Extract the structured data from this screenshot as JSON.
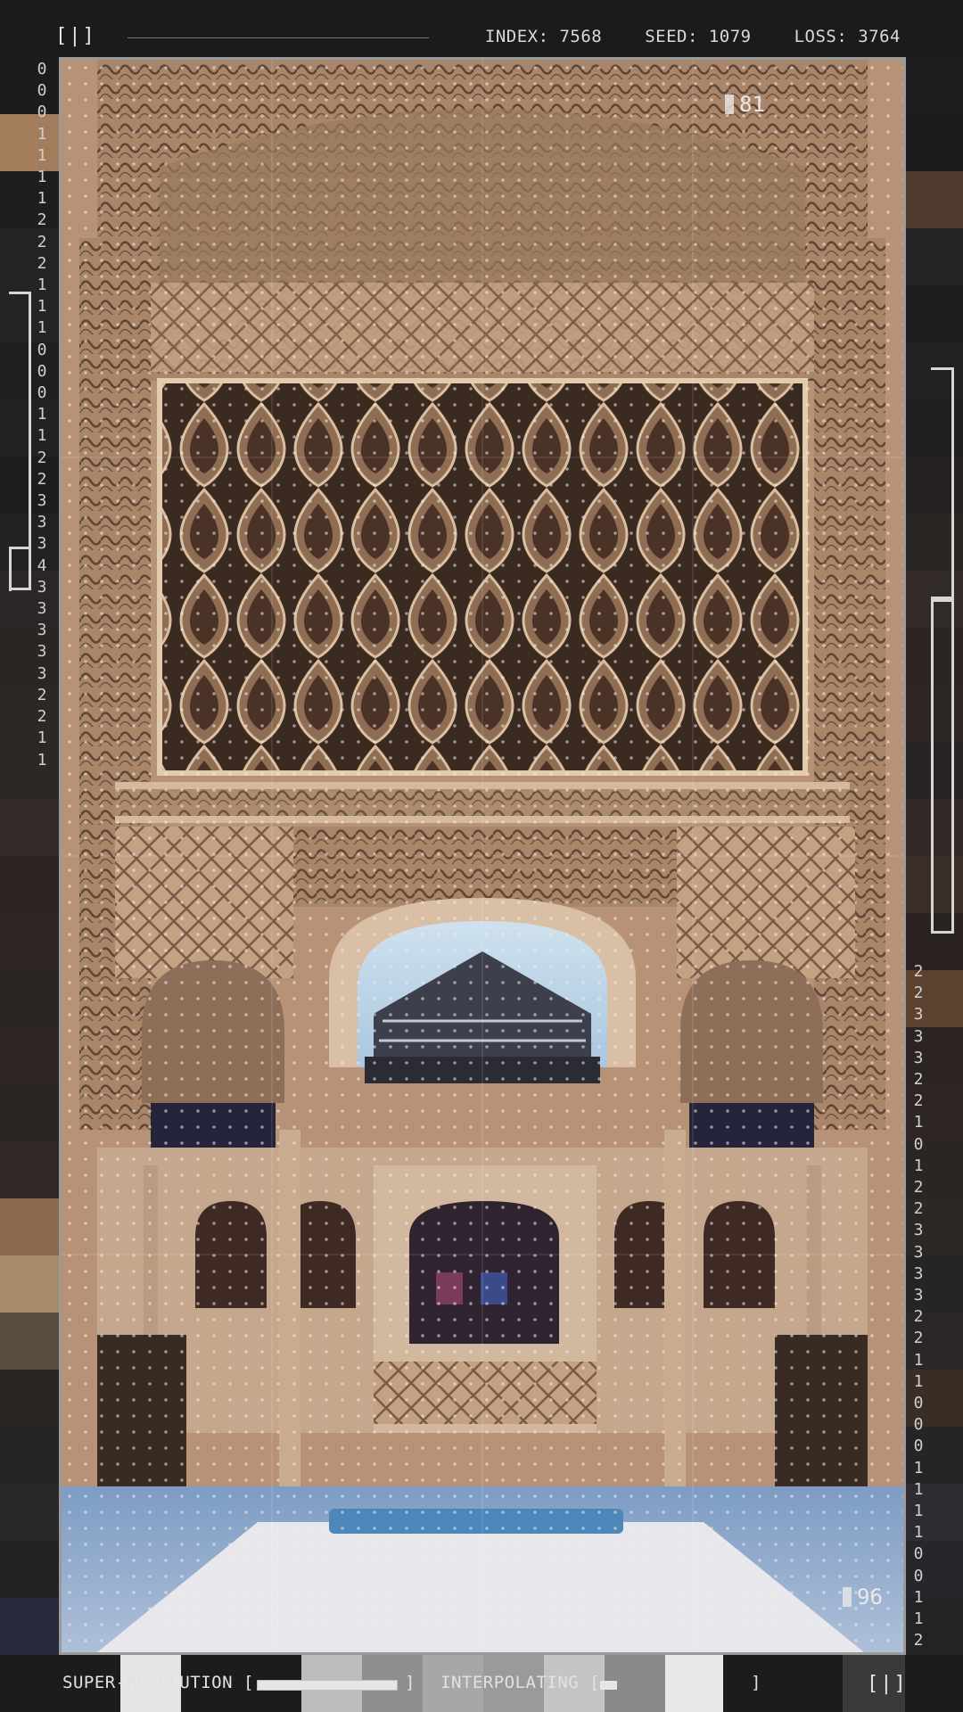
{
  "header": {
    "logo": "[|]",
    "index_label": "INDEX: 7568",
    "seed_label": "SEED: 1079",
    "loss_label": "LOSS: 3764"
  },
  "left_digits": [
    "0",
    "0",
    "0",
    "1",
    "1",
    "1",
    "1",
    "2",
    "2",
    "2",
    "1",
    "1",
    "1",
    "0",
    "0",
    "0",
    "1",
    "1",
    "2",
    "2",
    "3",
    "3",
    "3",
    "4",
    "3",
    "3",
    "3",
    "3",
    "3",
    "2",
    "2",
    "1",
    "1"
  ],
  "right_digits": [
    "2",
    "2",
    "3",
    "3",
    "3",
    "2",
    "2",
    "1",
    "0",
    "1",
    "2",
    "2",
    "3",
    "3",
    "3",
    "3",
    "2",
    "2",
    "1",
    "1",
    "0",
    "0",
    "0",
    "1",
    "1",
    "1",
    "1",
    "0",
    "0",
    "1",
    "1",
    "2"
  ],
  "image": {
    "tag_top": "81",
    "tag_bottom": "96",
    "subject_icon": "arched-courtyard-image"
  },
  "footer": {
    "superres_label": "SUPER-RESOLUTION [",
    "superres_close": "]",
    "superres_progress": 1.0,
    "interp_label": "INTERPOLATING [",
    "interp_close": "]",
    "interp_progress": 0.12,
    "logo": "[|]"
  },
  "colors": {
    "accent": "#e6e6e6",
    "stone": "#c9a98a",
    "sky": "#b8d2e6",
    "pool": "#5b8fbf"
  }
}
